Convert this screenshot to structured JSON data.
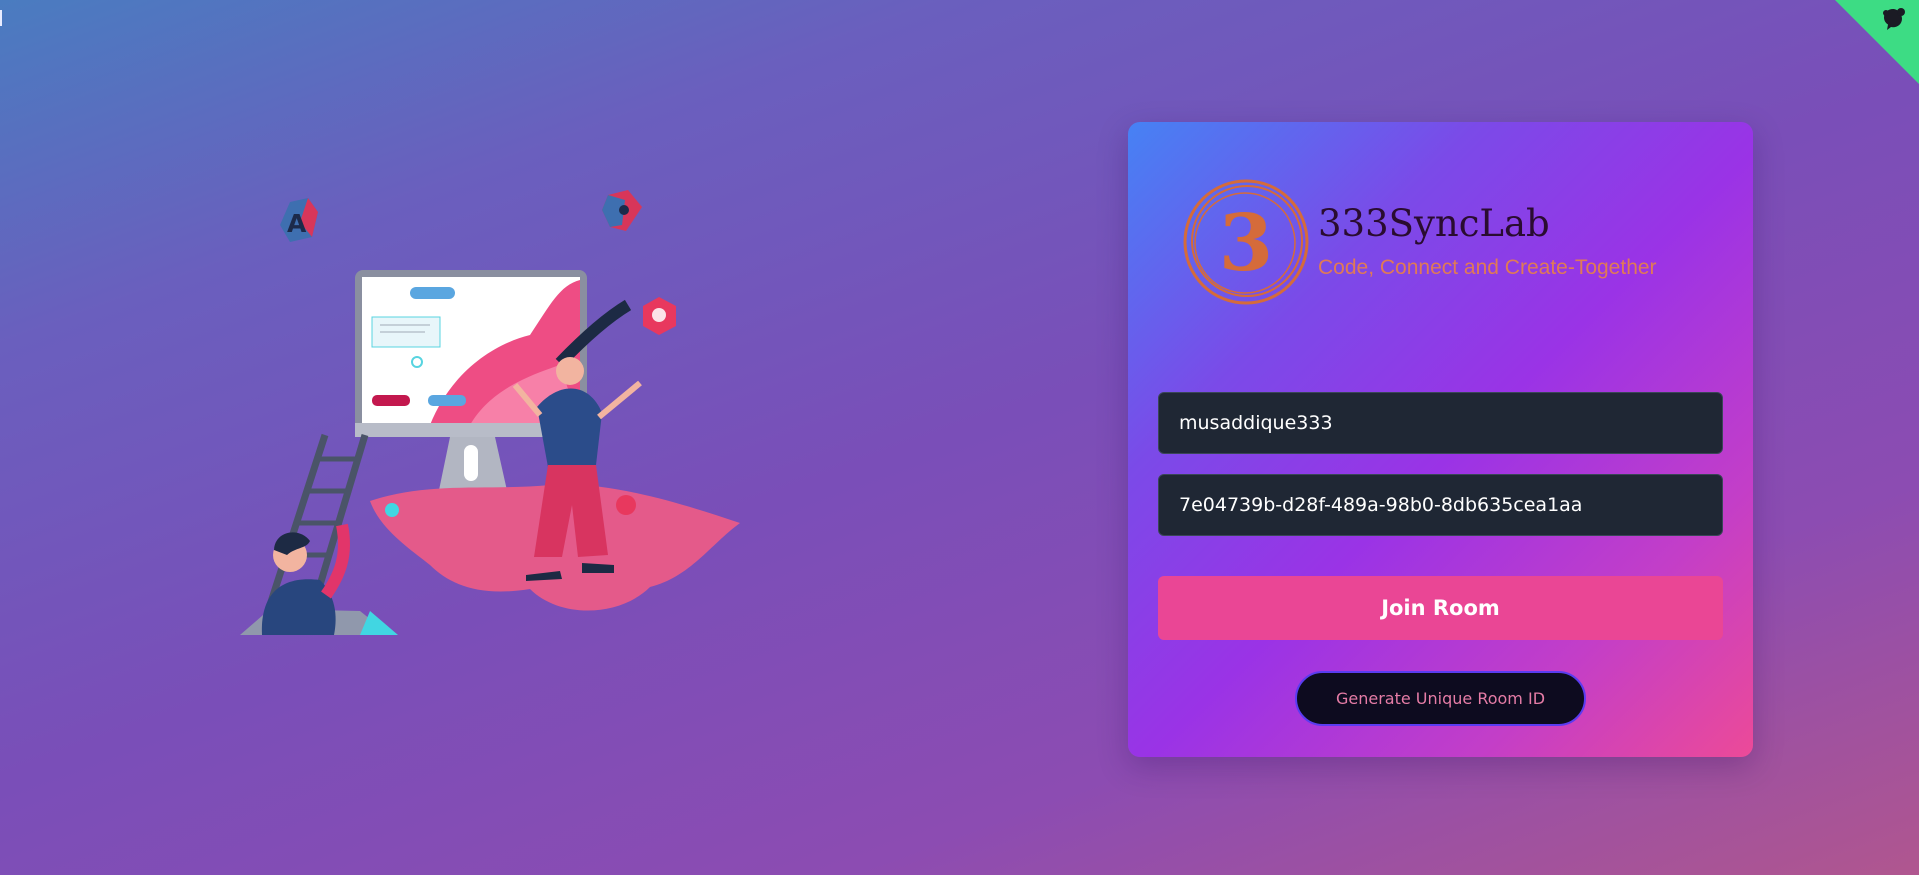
{
  "brand": {
    "logo_digit": "3",
    "title": "333SyncLab",
    "tagline": "Code, Connect and Create-Together"
  },
  "form": {
    "username_value": "musaddique333",
    "room_id_value": "7e04739b-d28f-489a-98b0-8db635cea1aa",
    "join_label": "Join Room",
    "generate_label": "Generate Unique Room ID"
  },
  "illustration": {
    "cube_letter": "A"
  },
  "icons": {
    "github_corner": "github-octocat-icon"
  },
  "colors": {
    "corner": "#3ddc84",
    "join_button": "#ea4695",
    "field_background": "#1f2734",
    "generate_button": "#0d0b1f",
    "tagline": "#e07a55"
  }
}
